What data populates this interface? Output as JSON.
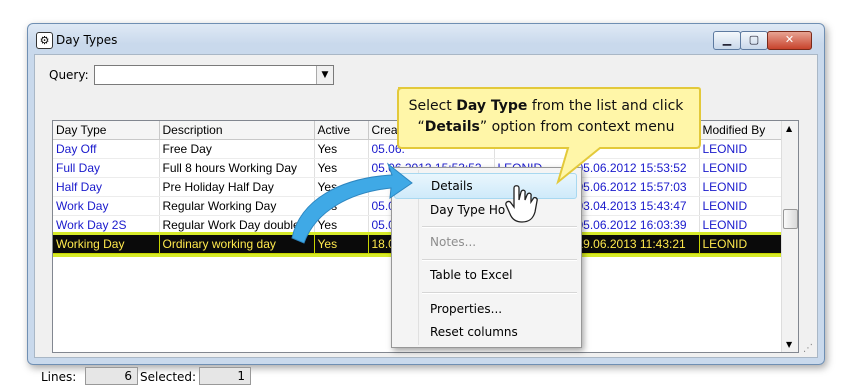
{
  "window": {
    "title": "Day Types",
    "icon": "gear-icon",
    "min_glyph": "▁",
    "max_glyph": "▢",
    "close_glyph": "✕"
  },
  "query": {
    "label": "Query:",
    "value": "",
    "arrow": "▼"
  },
  "table": {
    "columns": [
      "Day Type",
      "Description",
      "Active",
      "Create",
      "",
      "",
      "Modified By"
    ],
    "rows": [
      {
        "day_type": "Day Off",
        "description": "Free Day",
        "active": "Yes",
        "created": "05.06.",
        "created_by": "",
        "modified": "",
        "modified_by": "LEONID"
      },
      {
        "day_type": "Full Day",
        "description": "Full 8 hours Working Day",
        "active": "Yes",
        "created": "05.06.2012 15:53:52",
        "created_by": "LEONID",
        "modified": "05.06.2012 15:53:52",
        "modified_by": "LEONID"
      },
      {
        "day_type": "Half Day",
        "description": "Pre Holiday Half Day",
        "active": "Yes",
        "created": "",
        "created_by": "",
        "modified": "05.06.2012 15:57:03",
        "modified_by": "LEONID"
      },
      {
        "day_type": "Work Day",
        "description": "Regular Working Day",
        "active": "Yes",
        "created": "05.0",
        "created_by": "",
        "modified": "03.04.2013 15:43:47",
        "modified_by": "LEONID"
      },
      {
        "day_type": "Work Day 2S",
        "description": "Regular Work Day double",
        "active": "Yes",
        "created": "05.0",
        "created_by": "",
        "modified": "05.06.2012 16:03:39",
        "modified_by": "LEONID"
      },
      {
        "day_type": "Working Day",
        "description": "Ordinary working day",
        "active": "Yes",
        "created": "18.0",
        "created_by": "",
        "modified": "19.06.2013 11:43:21",
        "modified_by": "LEONID"
      }
    ],
    "selected_index": 5
  },
  "status": {
    "lines_label": "Lines:",
    "lines_value": "6",
    "selected_label": "Selected:",
    "selected_value": "1",
    "grip": "⋰"
  },
  "context_menu": {
    "items": [
      "Details",
      "Day Type Ho",
      "Notes...",
      "Table to Excel",
      "Properties...",
      "Reset columns"
    ],
    "highlighted": "Details",
    "disabled": [
      "Notes..."
    ]
  },
  "callout": {
    "line1_pre": "Select ",
    "line1_bold": "Day Type",
    "line1_post": " from the list and click",
    "line2_pre": "“",
    "line2_bold": "Details",
    "line2_post": "” option from context menu",
    "fill_color": "#fff6a8",
    "border_color": "#e3c93a",
    "arrow_color": "#3fa9e6"
  },
  "colors": {
    "link_blue": "#1a1acc",
    "selection_bg": "#0a0a0a",
    "selection_text": "#ffe94d",
    "highlight_outline": "#d6ea2a"
  }
}
